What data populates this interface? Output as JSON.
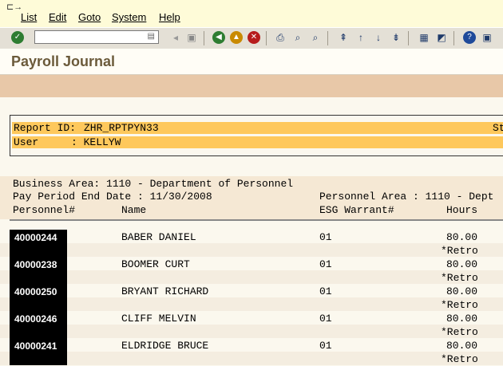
{
  "menu": [
    "List",
    "Edit",
    "Goto",
    "System",
    "Help"
  ],
  "toolbar": {
    "command_value": ""
  },
  "title": "Payroll Journal",
  "report": {
    "id_label": "Report ID:",
    "id_value": "ZHR_RPTPYN33",
    "right_cut": "St",
    "user_label": "User",
    "user_value": ": KELLYW"
  },
  "business_area": "Business Area: 1110 - Department of Personnel",
  "pay_period": "Pay Period End Date : 11/30/2008",
  "personnel_area": "Personnel Area : 1110 - Dept",
  "columns": {
    "personnel": "Personnel#",
    "name": "Name",
    "warrant": "ESG Warrant#",
    "hours": "Hours"
  },
  "rows": [
    {
      "personnel": "40000244",
      "name": "BABER DANIEL",
      "warrant": "01",
      "hours": "80.00",
      "note": "*Retro"
    },
    {
      "personnel": "40000238",
      "name": "BOOMER CURT",
      "warrant": "01",
      "hours": "80.00",
      "note": "*Retro"
    },
    {
      "personnel": "40000250",
      "name": "BRYANT RICHARD",
      "warrant": "01",
      "hours": "80.00",
      "note": "*Retro"
    },
    {
      "personnel": "40000246",
      "name": "CLIFF MELVIN",
      "warrant": "01",
      "hours": "80.00",
      "note": "*Retro"
    },
    {
      "personnel": "40000241",
      "name": "ELDRIDGE BRUCE",
      "warrant": "01",
      "hours": "80.00",
      "note": "*Retro"
    }
  ]
}
